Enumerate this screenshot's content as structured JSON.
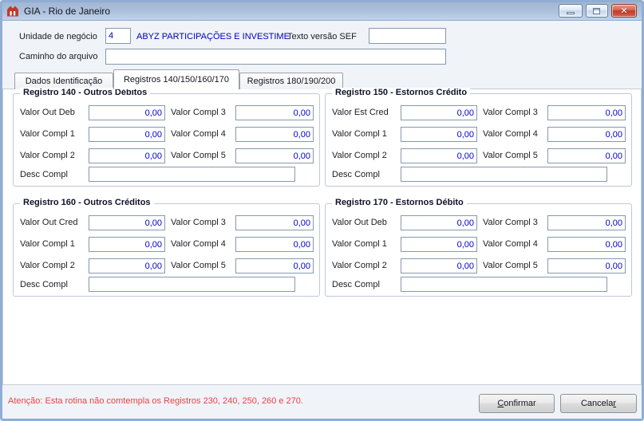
{
  "window": {
    "title": "GIA - Rio de Janeiro",
    "close_glyph": "✕",
    "icons": [
      "app-logo",
      "minimize",
      "maximize",
      "close"
    ]
  },
  "form": {
    "unidade_label": "Unidade de negócio",
    "unidade_value": "4",
    "company_text": "ABYZ PARTICIPAÇÕES E INVESTIME",
    "sef_label": "Texto versão SEF",
    "sef_value": "",
    "caminho_label": "Caminho do arquivo",
    "caminho_value": ""
  },
  "tabs": [
    {
      "label": "Dados Identificação",
      "active": false
    },
    {
      "label": "Registros 140/150/160/170",
      "active": true
    },
    {
      "label": "Registros 180/190/200",
      "active": false
    }
  ],
  "groups": [
    {
      "title": "Registro 140 - Outros Débitos",
      "fields": [
        {
          "label": "Valor Out Deb",
          "value": "0,00"
        },
        {
          "label": "Valor Compl 1",
          "value": "0,00"
        },
        {
          "label": "Valor Compl 2",
          "value": "0,00"
        },
        {
          "label": "Valor Compl 3",
          "value": "0,00"
        },
        {
          "label": "Valor Compl 4",
          "value": "0,00"
        },
        {
          "label": "Valor Compl 5",
          "value": "0,00"
        }
      ],
      "desc_label": "Desc Compl",
      "desc_value": ""
    },
    {
      "title": "Registro 150 - Estornos Crédito",
      "fields": [
        {
          "label": "Valor Est Cred",
          "value": "0,00"
        },
        {
          "label": "Valor Compl 1",
          "value": "0,00"
        },
        {
          "label": "Valor Compl 2",
          "value": "0,00"
        },
        {
          "label": "Valor Compl 3",
          "value": "0,00"
        },
        {
          "label": "Valor Compl 4",
          "value": "0,00"
        },
        {
          "label": "Valor Compl 5",
          "value": "0,00"
        }
      ],
      "desc_label": "Desc Compl",
      "desc_value": ""
    },
    {
      "title": "Registro 160 - Outros Créditos",
      "fields": [
        {
          "label": "Valor Out Cred",
          "value": "0,00"
        },
        {
          "label": "Valor Compl 1",
          "value": "0,00"
        },
        {
          "label": "Valor Compl 2",
          "value": "0,00"
        },
        {
          "label": "Valor Compl 3",
          "value": "0,00"
        },
        {
          "label": "Valor Compl 4",
          "value": "0,00"
        },
        {
          "label": "Valor Compl 5",
          "value": "0,00"
        }
      ],
      "desc_label": "Desc Compl",
      "desc_value": ""
    },
    {
      "title": "Registro 170 - Estornos Débito",
      "fields": [
        {
          "label": "Valor Out Deb",
          "value": "0,00"
        },
        {
          "label": "Valor Compl 1",
          "value": "0,00"
        },
        {
          "label": "Valor Compl 2",
          "value": "0,00"
        },
        {
          "label": "Valor Compl 3",
          "value": "0,00"
        },
        {
          "label": "Valor Compl 4",
          "value": "0,00"
        },
        {
          "label": "Valor Compl 5",
          "value": "0,00"
        }
      ],
      "desc_label": "Desc Compl",
      "desc_value": ""
    }
  ],
  "footer": {
    "warning": "Atenção: Esta rotina não comtempla os Registros 230, 240, 250, 260 e 270.",
    "confirm": {
      "u": "C",
      "rest": "onfirmar"
    },
    "cancel": {
      "pre": "Cancela",
      "u": "r"
    }
  },
  "colors": {
    "titlebar_top": "#a2b6d3",
    "titlebar_bottom": "#bfd3eb",
    "window_border": "#90aed4",
    "value_text": "#0000cc",
    "company_text": "#0000bb",
    "warning_text": "#e84444",
    "close_button": "#c03a28"
  }
}
